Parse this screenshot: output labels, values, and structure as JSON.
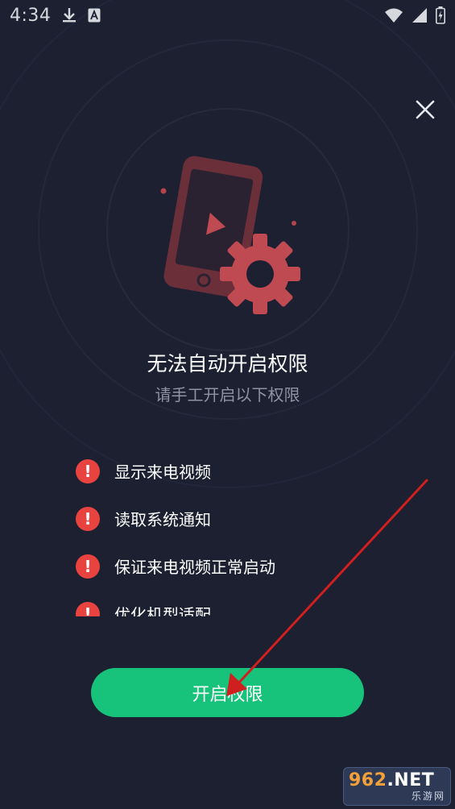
{
  "status_bar": {
    "time": "4:34",
    "icons": [
      "download-icon",
      "notification-a-icon",
      "wifi-icon",
      "signal-icon",
      "battery-icon"
    ]
  },
  "dialog": {
    "close_icon": "close-icon",
    "title": "无法自动开启权限",
    "subtitle": "请手工开启以下权限",
    "permissions": [
      {
        "label": "显示来电视频",
        "icon": "warning-icon"
      },
      {
        "label": "读取系统通知",
        "icon": "warning-icon"
      },
      {
        "label": "保证来电视频正常启动",
        "icon": "warning-icon"
      },
      {
        "label": "优化机型适配",
        "icon": "warning-icon"
      }
    ],
    "warning_glyph": "!",
    "primary_button": "开启权限"
  },
  "watermark": {
    "brand_num": "962",
    "brand_suffix": ".NET",
    "sub": "乐游网"
  },
  "colors": {
    "background": "#1c2030",
    "accent_green": "#17c27a",
    "warning_red": "#e8433f",
    "illustration": "#c04a52",
    "subtitle_gray": "#8e93a3"
  }
}
